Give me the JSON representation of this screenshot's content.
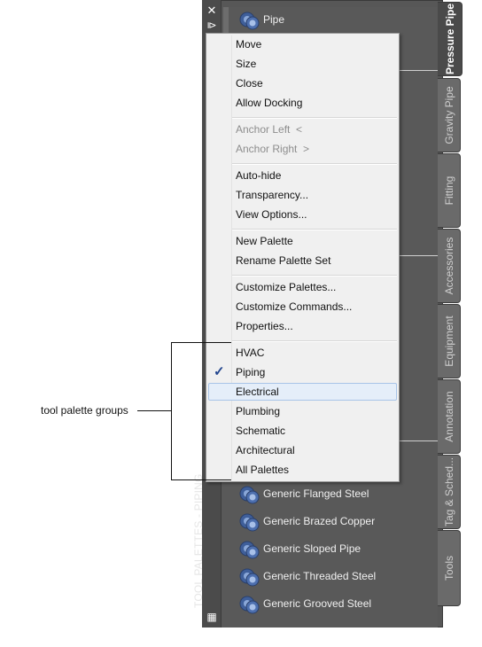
{
  "palette": {
    "title": "TOOL PALETTES - PIPING",
    "top_item": {
      "label": "Pipe",
      "icon": "pipe-tool-icon"
    },
    "items": [
      {
        "label": "Generic Flanged Steel",
        "icon": "pipe-tool-icon"
      },
      {
        "label": "Generic Brazed Copper",
        "icon": "pipe-tool-icon"
      },
      {
        "label": "Generic Sloped Pipe",
        "icon": "pipe-tool-icon"
      },
      {
        "label": "Generic Threaded Steel",
        "icon": "pipe-tool-icon"
      },
      {
        "label": "Generic Grooved Steel",
        "icon": "pipe-tool-icon"
      }
    ],
    "tabs": [
      {
        "label": "Pressure Pipe",
        "active": true
      },
      {
        "label": "Gravity Pipe",
        "active": false
      },
      {
        "label": "Fitting",
        "active": false
      },
      {
        "label": "Accessories",
        "active": false
      },
      {
        "label": "Equipment",
        "active": false
      },
      {
        "label": "Annotation",
        "active": false
      },
      {
        "label": "Tag & Sched...",
        "active": false
      },
      {
        "label": "Tools",
        "active": false
      }
    ]
  },
  "menu": {
    "group1": [
      "Move",
      "Size",
      "Close",
      "Allow Docking"
    ],
    "group2": [
      "Anchor Left  <",
      "Anchor Right  >"
    ],
    "group3": [
      "Auto-hide",
      "Transparency...",
      "View Options..."
    ],
    "group4": [
      "New Palette",
      "Rename Palette Set"
    ],
    "group5": [
      "Customize Palettes...",
      "Customize Commands...",
      "Properties..."
    ],
    "group6": [
      "HVAC",
      "Piping",
      "Electrical",
      "Plumbing",
      "Schematic",
      "Architectural",
      "All Palettes"
    ],
    "checked_item": "Piping",
    "highlighted_item": "Electrical"
  },
  "callout": {
    "label": "tool palette groups"
  },
  "colors": {
    "palette_bg": "#595959",
    "menu_bg": "#f0f0f0",
    "highlight_bg": "#e5eef9",
    "check_color": "#23468f"
  }
}
